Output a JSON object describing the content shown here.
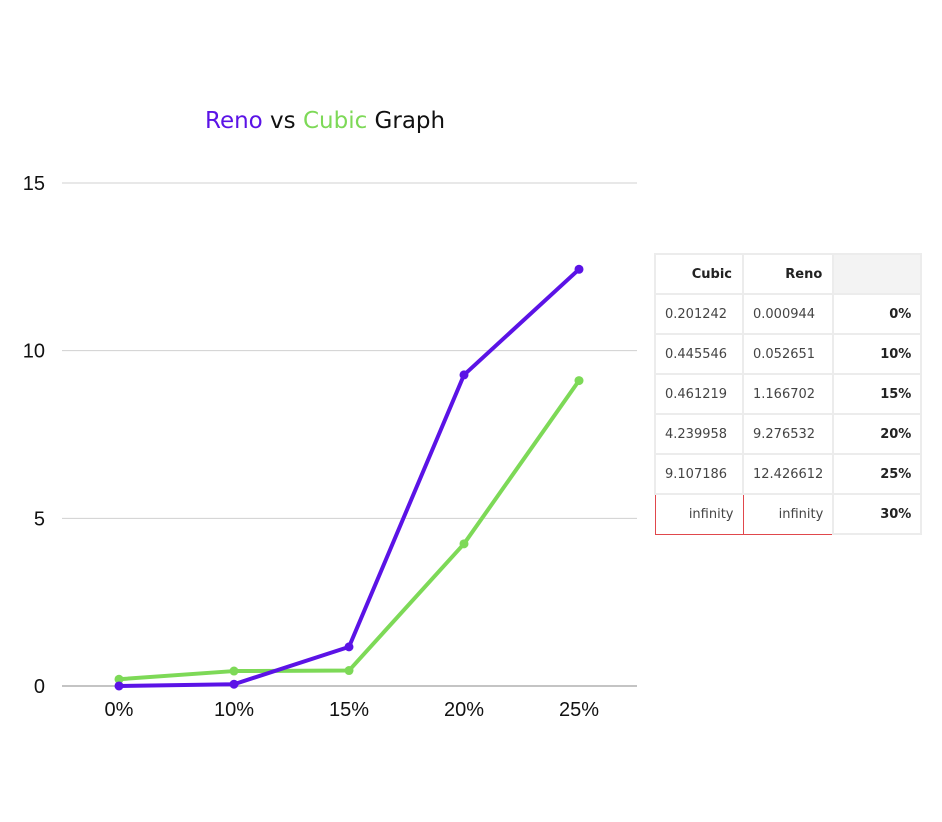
{
  "title": {
    "part1": "Reno",
    "part2": " vs ",
    "part3": "Cubic",
    "part4": " Graph",
    "color1": "#5b13e6",
    "color2": "#111111",
    "color3": "#7dd957",
    "color4": "#111111"
  },
  "chart_data": {
    "type": "line",
    "title": "Reno vs Cubic Graph",
    "xlabel": "",
    "ylabel": "",
    "categories": [
      "0%",
      "10%",
      "15%",
      "20%",
      "25%"
    ],
    "ylim": [
      0,
      15
    ],
    "yticks": [
      0,
      5,
      10,
      15
    ],
    "grid": true,
    "series": [
      {
        "name": "Reno",
        "color": "#5b13e6",
        "values": [
          0.000944,
          0.052651,
          1.166702,
          9.276532,
          12.426612
        ]
      },
      {
        "name": "Cubic",
        "color": "#7dd957",
        "values": [
          0.201242,
          0.445546,
          0.461219,
          4.239958,
          9.107186
        ]
      }
    ]
  },
  "table": {
    "headers": [
      "Cubic",
      "Reno",
      ""
    ],
    "rows": [
      {
        "cubic": "0.201242",
        "reno": "0.000944",
        "label": "0%"
      },
      {
        "cubic": "0.445546",
        "reno": "0.052651",
        "label": "10%"
      },
      {
        "cubic": "0.461219",
        "reno": "1.166702",
        "label": "15%"
      },
      {
        "cubic": "4.239958",
        "reno": "9.276532",
        "label": "20%"
      },
      {
        "cubic": "9.107186",
        "reno": "12.426612",
        "label": "25%"
      },
      {
        "cubic": "infinity",
        "reno": "infinity",
        "label": "30%"
      }
    ]
  }
}
